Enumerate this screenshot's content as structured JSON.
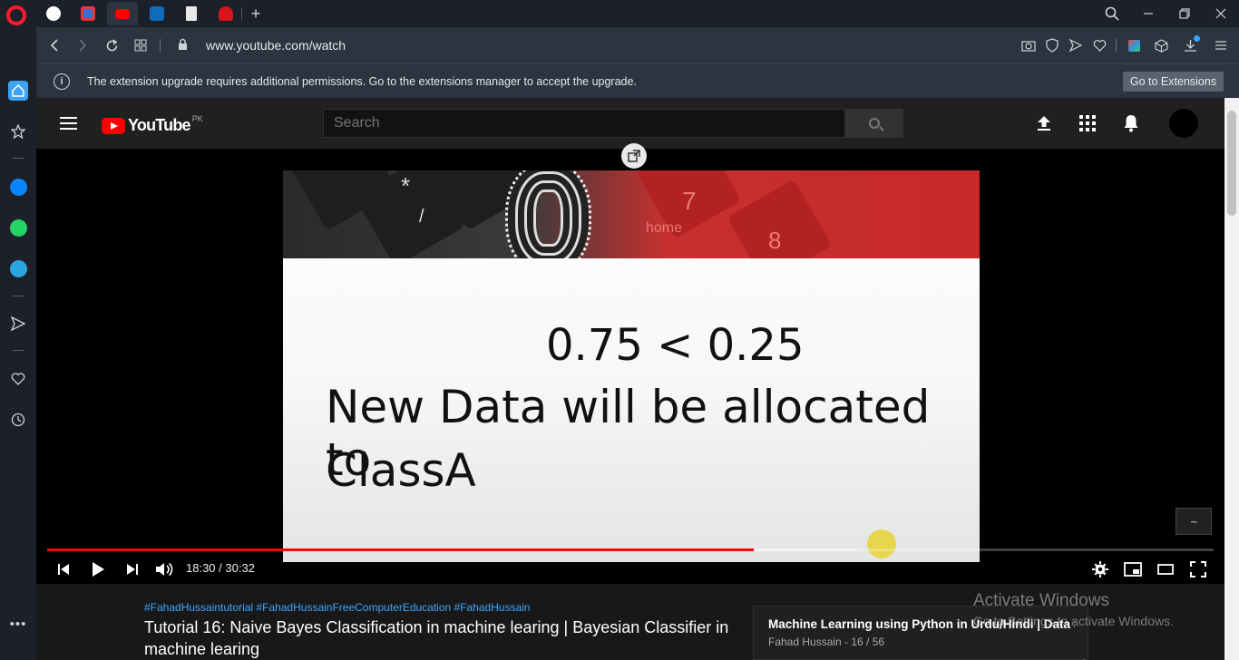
{
  "browser": {
    "url": "www.youtube.com/watch",
    "notice_text": "The extension upgrade requires additional permissions. Go to the extensions manager to accept the upgrade.",
    "notice_button": "Go to Extensions",
    "icons": {
      "tab_favicons": [
        "github-icon",
        "google-calendar-icon",
        "youtube-icon",
        "outlook-icon",
        "document-icon",
        "huawei-icon"
      ],
      "sidebar": [
        "home-icon",
        "bookmarks-icon",
        "messenger-icon",
        "whatsapp-icon",
        "telegram-icon",
        "flow-icon",
        "heart-icon",
        "history-icon",
        "more-icon"
      ]
    },
    "colors": {
      "opera_red": "#ff1b2d",
      "chrome_bg": "#1b2029",
      "bar_bg": "#2c3440"
    }
  },
  "youtube": {
    "country_code": "PK",
    "search_placeholder": "Search",
    "colors": {
      "brand_red": "#ff0000",
      "link_blue": "#3ea6ff"
    }
  },
  "player": {
    "slide": {
      "line1": "0.75 < 0.25",
      "line2": "New Data will be allocated to",
      "line3": "ClassA",
      "keyboard_labels": [
        "*",
        "/",
        "7",
        "home",
        "8"
      ]
    },
    "current_time": "18:30",
    "duration": "30:32",
    "time_display": "18:30 / 30:32",
    "progress_fraction": 0.606,
    "buffered_fraction": 0.694
  },
  "video_info": {
    "hashtags": "#FahadHussaintutorial #FahadHussainFreeComputerEducation #FahadHussain",
    "title": "Tutorial 16: Naive Bayes Classification in machine learing | Bayesian Classifier in machine learing"
  },
  "playlist": {
    "title": "Machine Learning using Python in Urdu/Hindi | Data S",
    "meta": "Fahad Hussain - 16 / 56"
  },
  "os_overlay": {
    "line1": "Activate Windows",
    "line2": "Go to Settings to activate Windows."
  }
}
